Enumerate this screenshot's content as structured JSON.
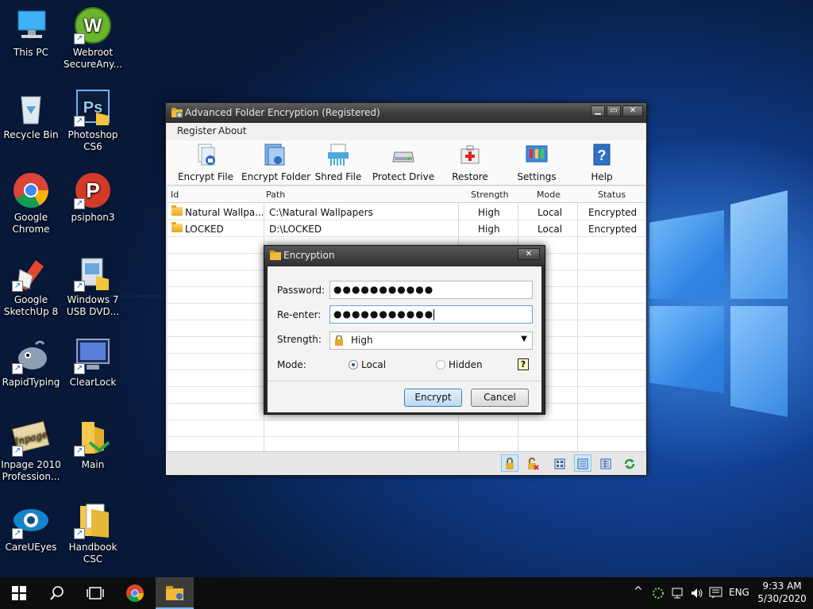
{
  "desktop": {
    "icons": [
      {
        "label1": "This PC",
        "label2": ""
      },
      {
        "label1": "Webroot",
        "label2": "SecureAny..."
      },
      {
        "label1": "Recycle Bin",
        "label2": ""
      },
      {
        "label1": "Photoshop",
        "label2": "CS6"
      },
      {
        "label1": "Google",
        "label2": "Chrome"
      },
      {
        "label1": "psiphon3",
        "label2": ""
      },
      {
        "label1": "Google",
        "label2": "SketchUp 8"
      },
      {
        "label1": "Windows 7",
        "label2": "USB DVD..."
      },
      {
        "label1": "RapidTyping",
        "label2": ""
      },
      {
        "label1": "ClearLock",
        "label2": ""
      },
      {
        "label1": "Inpage 2010",
        "label2": "Profession..."
      },
      {
        "label1": "Main",
        "label2": ""
      },
      {
        "label1": "CareUEyes",
        "label2": ""
      },
      {
        "label1": "Handbook",
        "label2": "CSC"
      }
    ]
  },
  "main_window": {
    "title": "Advanced Folder Encryption (Registered)",
    "menu": [
      "Register",
      "About"
    ],
    "toolbar": [
      "Encrypt File",
      "Encrypt Folder",
      "Shred File",
      "Protect Drive",
      "Restore",
      "Settings",
      "Help"
    ],
    "columns": [
      "Id",
      "Path",
      "Strength",
      "Mode",
      "Status"
    ],
    "rows": [
      {
        "id": "Natural Wallpa...",
        "path": "C:\\Natural Wallpapers",
        "strength": "High",
        "mode": "Local",
        "status": "Encrypted"
      },
      {
        "id": "LOCKED",
        "path": "D:\\LOCKED",
        "strength": "High",
        "mode": "Local",
        "status": "Encrypted"
      }
    ]
  },
  "dialog": {
    "title": "Encryption",
    "password_label": "Password:",
    "password_value": "●●●●●●●●●●●",
    "reenter_label": "Re-enter:",
    "reenter_value": "●●●●●●●●●●●",
    "strength_label": "Strength:",
    "strength_value": "High",
    "mode_label": "Mode:",
    "mode_local": "Local",
    "mode_hidden": "Hidden",
    "mode_selected": "Local",
    "help_glyph": "?",
    "encrypt_label": "Encrypt",
    "cancel_label": "Cancel"
  },
  "taskbar": {
    "language": "ENG",
    "time": "9:33 AM",
    "date": "5/30/2020"
  }
}
